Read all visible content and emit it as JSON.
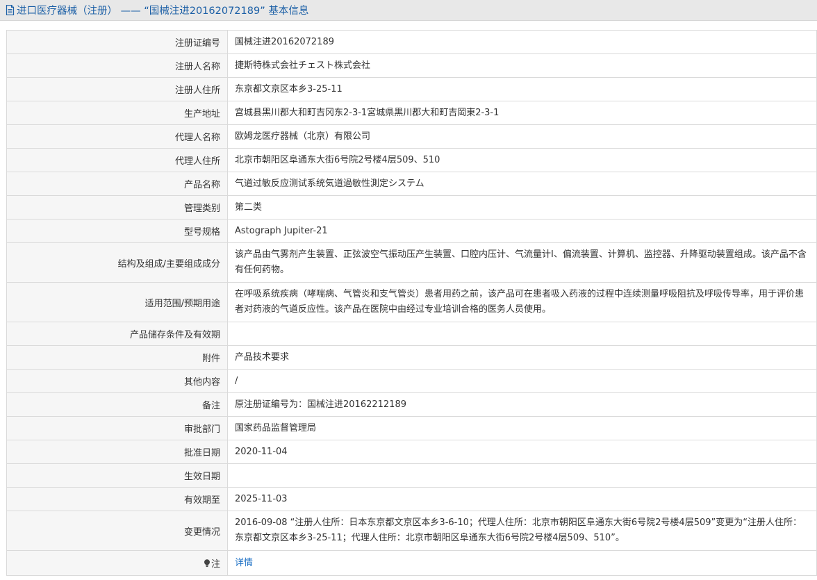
{
  "header": {
    "title": "进口医疗器械（注册） —— “国械注进20162072189” 基本信息",
    "icon": "document-icon"
  },
  "rows": [
    {
      "label": "注册证编号",
      "value": "国械注进20162072189"
    },
    {
      "label": "注册人名称",
      "value": "捷斯特株式会社チェスト株式会社"
    },
    {
      "label": "注册人住所",
      "value": "东京都文京区本乡3-25-11"
    },
    {
      "label": "生产地址",
      "value": "宫城县黑川郡大和町吉冈东2-3-1宮城県黒川郡大和町吉岡東2-3-1"
    },
    {
      "label": "代理人名称",
      "value": "欧姆龙医疗器械（北京）有限公司"
    },
    {
      "label": "代理人住所",
      "value": "北京市朝阳区阜通东大街6号院2号楼4层509、510"
    },
    {
      "label": "产品名称",
      "value": "气道过敏反应测试系统気道過敏性測定システム"
    },
    {
      "label": "管理类别",
      "value": "第二类"
    },
    {
      "label": "型号规格",
      "value": "Astograph Jupiter-21"
    },
    {
      "label": "结构及组成/主要组成成分",
      "value": "该产品由气雾剂产生装置、正弦波空气振动压产生装置、口腔内压计、气流量计Ⅰ、偏流装置、计算机、监控器、升降驱动装置组成。该产品不含有任何药物。"
    },
    {
      "label": "适用范围/预期用途",
      "value": "在呼吸系统疾病（哮喘病、气管炎和支气管炎）患者用药之前，该产品可在患者吸入药液的过程中连续测量呼吸阻抗及呼吸传导率，用于评价患者对药液的气道反应性。该产品在医院中由经过专业培训合格的医务人员使用。"
    },
    {
      "label": "产品储存条件及有效期",
      "value": ""
    },
    {
      "label": "附件",
      "value": "产品技术要求"
    },
    {
      "label": "其他内容",
      "value": "/"
    },
    {
      "label": "备注",
      "value": "原注册证编号为：国械注进20162212189"
    },
    {
      "label": "审批部门",
      "value": "国家药品监督管理局"
    },
    {
      "label": "批准日期",
      "value": "2020-11-04"
    },
    {
      "label": "生效日期",
      "value": ""
    },
    {
      "label": "有效期至",
      "value": "2025-11-03"
    },
    {
      "label": "变更情况",
      "value": "2016-09-08 “注册人住所：日本东京都文京区本乡3-6-10；代理人住所：北京市朝阳区阜通东大街6号院2号楼4层509”变更为“注册人住所：东京都文京区本乡3-25-11；代理人住所：北京市朝阳区阜通东大街6号院2号楼4层509、510”。"
    }
  ],
  "note": {
    "label": "注",
    "icon": "lightbulb-icon",
    "link_text": "详情",
    "link_color": "#1b6fc4"
  },
  "colors": {
    "header_bg": "#e8e8e8",
    "header_text": "#1b5fa6",
    "label_bg": "#f6f6f6",
    "border": "#dadada"
  }
}
